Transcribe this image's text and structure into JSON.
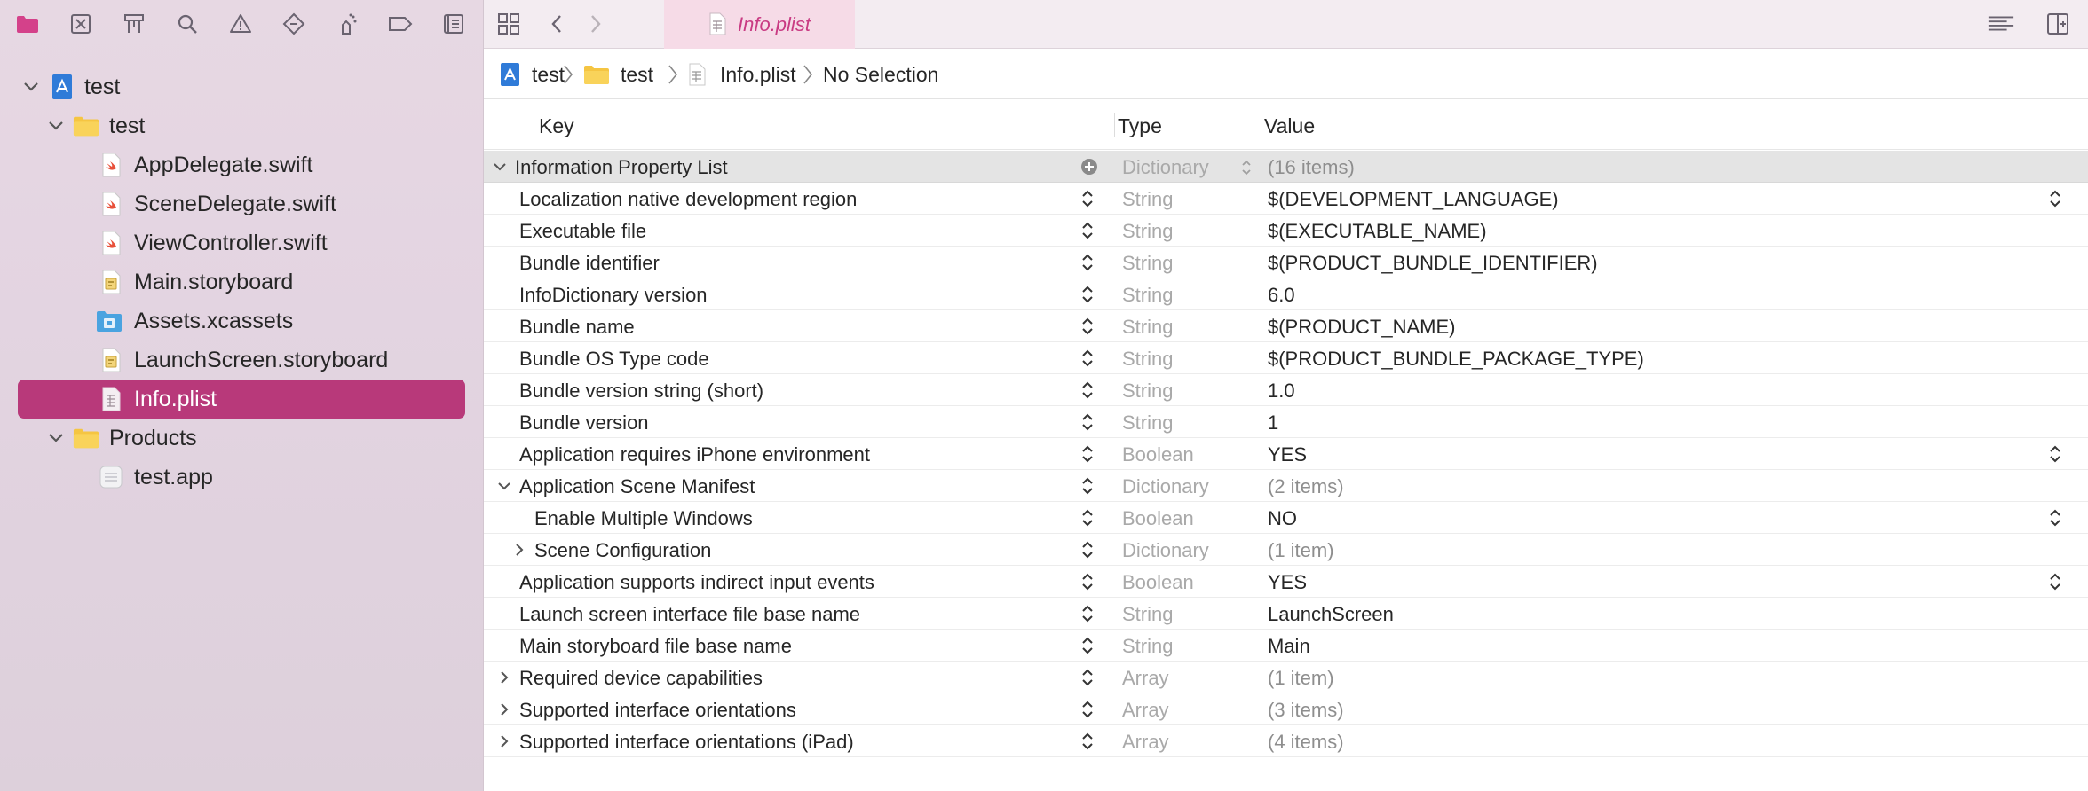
{
  "navigator": {
    "toolbar_icons": [
      "folder-icon",
      "source-control-icon",
      "symbol-icon",
      "search-icon",
      "warning-icon",
      "test-icon",
      "debug-icon",
      "breakpoint-icon",
      "report-icon"
    ],
    "tree": [
      {
        "label": "test",
        "icon": "project-icon",
        "level": 0,
        "disclosure": "open"
      },
      {
        "label": "test",
        "icon": "folder-icon",
        "level": 1,
        "disclosure": "open"
      },
      {
        "label": "AppDelegate.swift",
        "icon": "swift-file-icon",
        "level": 2
      },
      {
        "label": "SceneDelegate.swift",
        "icon": "swift-file-icon",
        "level": 2
      },
      {
        "label": "ViewController.swift",
        "icon": "swift-file-icon",
        "level": 2
      },
      {
        "label": "Main.storyboard",
        "icon": "storyboard-icon",
        "level": 2
      },
      {
        "label": "Assets.xcassets",
        "icon": "asset-catalog-icon",
        "level": 2
      },
      {
        "label": "LaunchScreen.storyboard",
        "icon": "storyboard-icon",
        "level": 2
      },
      {
        "label": "Info.plist",
        "icon": "plist-file-icon",
        "level": 2,
        "selected": true
      },
      {
        "label": "Products",
        "icon": "folder-icon",
        "level": 1,
        "disclosure": "open"
      },
      {
        "label": "test.app",
        "icon": "app-icon",
        "level": 2
      }
    ]
  },
  "tab": {
    "label": "Info.plist"
  },
  "jumpbar": {
    "crumb1": "test",
    "crumb2": "test",
    "crumb3": "Info.plist",
    "crumb4": "No Selection"
  },
  "plist": {
    "headers": {
      "key": "Key",
      "type": "Type",
      "value": "Value"
    },
    "root": {
      "key": "Information Property List",
      "type": "Dictionary",
      "value": "(16 items)"
    },
    "rows": [
      {
        "key": "Localization native development region",
        "type": "String",
        "value": "$(DEVELOPMENT_LANGUAGE)",
        "indent": 1,
        "popup": true
      },
      {
        "key": "Executable file",
        "type": "String",
        "value": "$(EXECUTABLE_NAME)",
        "indent": 1
      },
      {
        "key": "Bundle identifier",
        "type": "String",
        "value": "$(PRODUCT_BUNDLE_IDENTIFIER)",
        "indent": 1
      },
      {
        "key": "InfoDictionary version",
        "type": "String",
        "value": "6.0",
        "indent": 1
      },
      {
        "key": "Bundle name",
        "type": "String",
        "value": "$(PRODUCT_NAME)",
        "indent": 1
      },
      {
        "key": "Bundle OS Type code",
        "type": "String",
        "value": "$(PRODUCT_BUNDLE_PACKAGE_TYPE)",
        "indent": 1
      },
      {
        "key": "Bundle version string (short)",
        "type": "String",
        "value": "1.0",
        "indent": 1
      },
      {
        "key": "Bundle version",
        "type": "String",
        "value": "1",
        "indent": 1
      },
      {
        "key": "Application requires iPhone environment",
        "type": "Boolean",
        "value": "YES",
        "indent": 1,
        "popup": true
      },
      {
        "key": "Application Scene Manifest",
        "type": "Dictionary",
        "value": "(2 items)",
        "indent": 1,
        "disclosure": "open",
        "muted": true
      },
      {
        "key": "Enable Multiple Windows",
        "type": "Boolean",
        "value": "NO",
        "indent": 2,
        "popup": true
      },
      {
        "key": "Scene Configuration",
        "type": "Dictionary",
        "value": "(1 item)",
        "indent": 2,
        "disclosure": "closed",
        "muted": true
      },
      {
        "key": "Application supports indirect input events",
        "type": "Boolean",
        "value": "YES",
        "indent": 1,
        "popup": true
      },
      {
        "key": "Launch screen interface file base name",
        "type": "String",
        "value": "LaunchScreen",
        "indent": 1
      },
      {
        "key": "Main storyboard file base name",
        "type": "String",
        "value": "Main",
        "indent": 1
      },
      {
        "key": "Required device capabilities",
        "type": "Array",
        "value": "(1 item)",
        "indent": 1,
        "disclosure": "closed",
        "muted": true
      },
      {
        "key": "Supported interface orientations",
        "type": "Array",
        "value": "(3 items)",
        "indent": 1,
        "disclosure": "closed",
        "muted": true
      },
      {
        "key": "Supported interface orientations (iPad)",
        "type": "Array",
        "value": "(4 items)",
        "indent": 1,
        "disclosure": "closed",
        "muted": true
      }
    ]
  },
  "colors": {
    "accent": "#b8397a",
    "tab_text": "#c93b83",
    "swift": "#e8503a",
    "folder": "#f5c542",
    "project": "#2f7bd8"
  }
}
